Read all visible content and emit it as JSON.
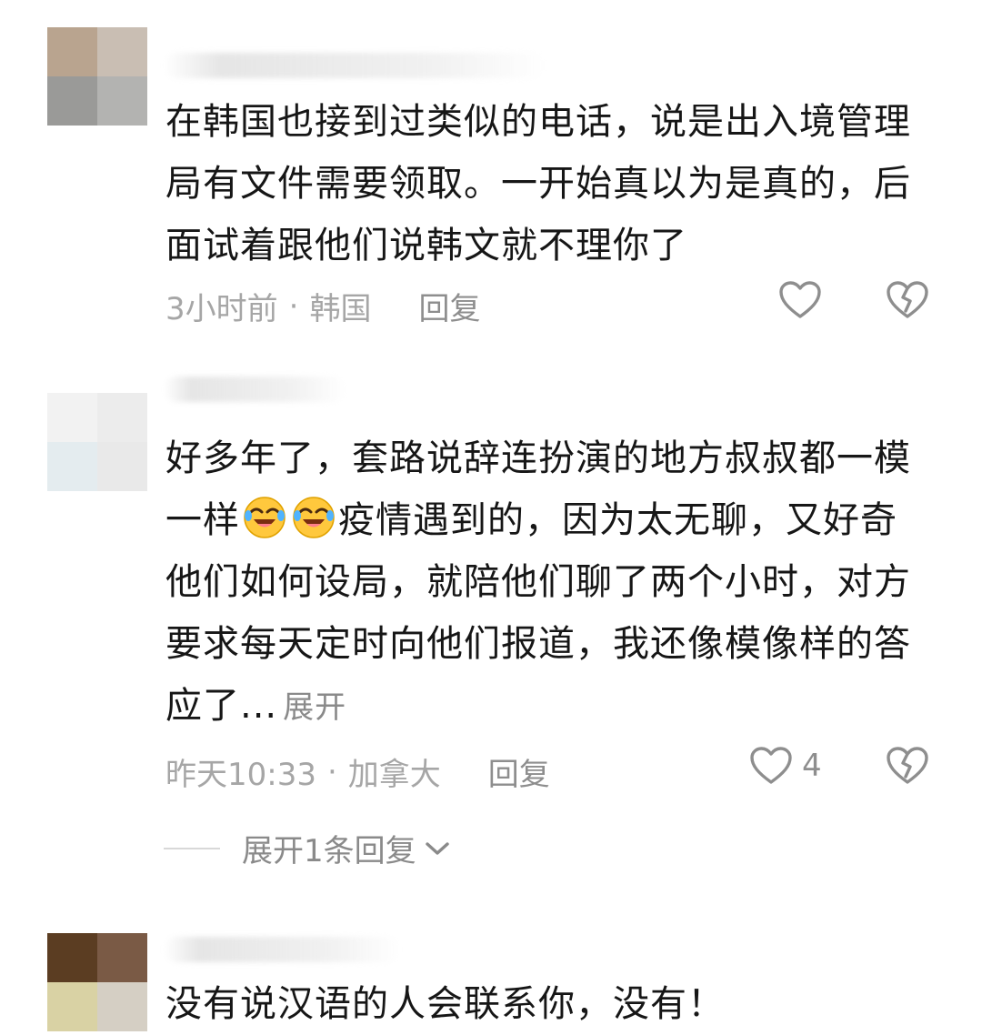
{
  "comments": [
    {
      "nickname": "",
      "text": "在韩国也接到过类似的电话，说是出入境管理局有文件需要领取。一开始真以为是真的，后面试着跟他们说韩文就不理你了",
      "time": "3小时前",
      "location": "韩国",
      "reply_label": "回复",
      "like_count": "",
      "avatar_colors": [
        "#b9a48f",
        "#c9beb3",
        "#9a9a98",
        "#b3b3b1"
      ]
    },
    {
      "nickname": "",
      "text_part1": "好多年了，套路说辞连扮演的地方叔叔都一模一样",
      "text_part2": "疫情遇到的，因为太无聊，又好奇他们如何设局，就陪他们聊了两个小时，对方要求每天定时向他们报道，我还像模像样的答应了...",
      "expand_label": "展开",
      "time": "昨天10:33",
      "location": "加拿大",
      "reply_label": "回复",
      "like_count": "4",
      "replies_toggle": "展开1条回复",
      "emoji": [
        "laughing-crying-emoji",
        "laughing-crying-emoji"
      ],
      "avatar_colors": [
        "#f2f2f2",
        "#ececec",
        "#e4ecef",
        "#e9e9e9"
      ]
    },
    {
      "nickname": "",
      "text": "没有说汉语的人会联系你，没有！",
      "avatar_colors": [
        "#5b3d22",
        "#7a5a45",
        "#d9d2a4",
        "#d5cfc4"
      ]
    }
  ],
  "colors": {
    "meta": "#a6a6a6",
    "text": "#161616",
    "icon": "#8e8e8e"
  }
}
